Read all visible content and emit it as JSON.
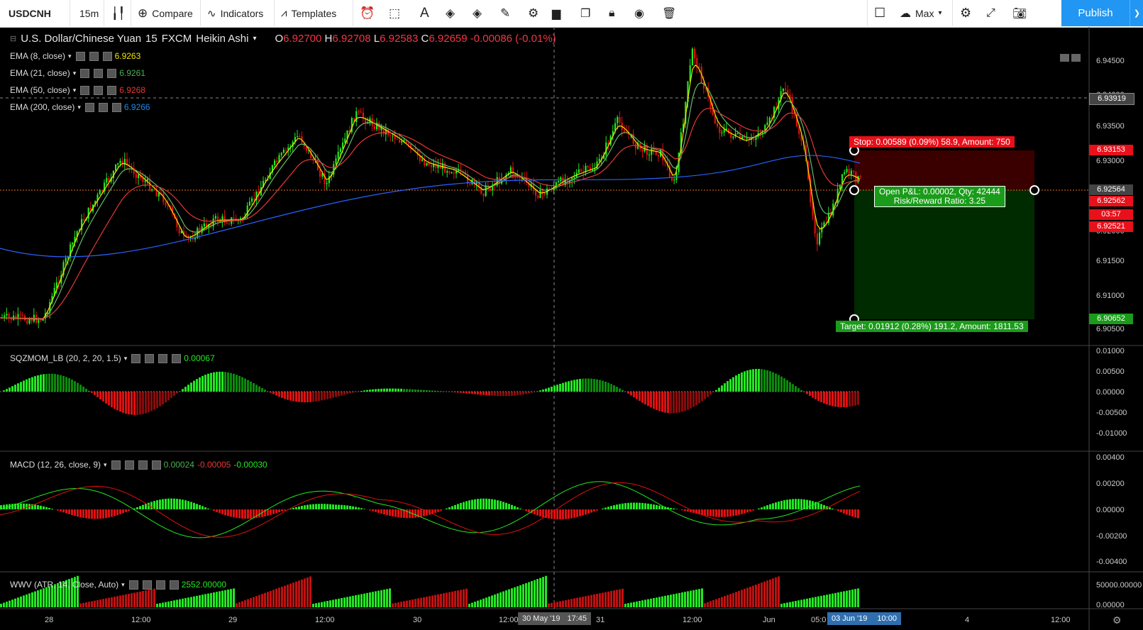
{
  "toolbar": {
    "symbol": "USDCNH",
    "interval": "15m",
    "compare": "Compare",
    "indicators": "Indicators",
    "templates": "Templates",
    "max": "Max",
    "publish": "Publish"
  },
  "header": {
    "title": "U.S. Dollar/Chinese Yuan",
    "interval": "15",
    "exchange": "FXCM",
    "style": "Heikin Ashi",
    "o_label": "O",
    "o": "6.92700",
    "h_label": "H",
    "h": "6.92708",
    "l_label": "L",
    "l": "6.92583",
    "c_label": "C",
    "c": "6.92659",
    "change": "-0.00086 (-0.01%)"
  },
  "legends": {
    "ema8": {
      "label": "EMA (8, close)",
      "value": "6.9263",
      "color": "#f5e400"
    },
    "ema21": {
      "label": "EMA (21, close)",
      "value": "6.9261",
      "color": "#4caf50"
    },
    "ema50": {
      "label": "EMA (50, close)",
      "value": "6.9268",
      "color": "#e53935"
    },
    "ema200": {
      "label": "EMA (200, close)",
      "value": "6.9266",
      "color": "#1e88e5"
    },
    "sqz": {
      "label": "SQZMOM_LB (20, 2, 20, 1.5)",
      "value": "0.00067"
    },
    "macd": {
      "label": "MACD (12, 26, close, 9)",
      "v1": "0.00024",
      "v2": "-0.00005",
      "v3": "-0.00030"
    },
    "wvv": {
      "label": "WWV (ATR, 14, Close, Auto)",
      "value": "2552.00000"
    }
  },
  "position": {
    "stop": "Stop: 0.00589 (0.09%) 58.9, Amount: 750",
    "pnl": "Open P&L: 0.00002, Qty: 42444",
    "rr": "Risk/Reward Ratio: 3.25",
    "target": "Target: 0.01912 (0.28%) 191.2, Amount: 1811.53"
  },
  "price_axis": {
    "ticks": [
      "6.94500",
      "6.94000",
      "6.93500",
      "6.93000",
      "6.92500",
      "6.92000",
      "6.91500",
      "6.91000",
      "6.90500"
    ],
    "labels": {
      "crosshair": "6.93919",
      "stop": "6.93153",
      "entry": "6.92564",
      "last": "6.92562",
      "countdown": "03:57",
      "low": "6.92521",
      "target": "6.90652"
    }
  },
  "sqz_axis": [
    "0.01000",
    "0.00500",
    "0.00000",
    "-0.00500",
    "-0.01000"
  ],
  "macd_axis": [
    "0.00400",
    "0.00200",
    "0.00000",
    "-0.00200",
    "-0.00400"
  ],
  "wvv_axis": [
    "50000.00000",
    "0.00000"
  ],
  "time_axis": {
    "ticks": [
      "28",
      "12:00",
      "29",
      "12:00",
      "30",
      "12:00",
      "31",
      "12:00",
      "Jun",
      "05:0",
      "4",
      "12:00"
    ],
    "cursor_date": "30 May '19",
    "cursor_time": "17:45",
    "cursor2_date": "03 Jun '19",
    "cursor2_time": "10:00"
  },
  "colors": {
    "up": "#22e822",
    "down": "#e01010",
    "ema200": "#2962ff",
    "ema50": "#e53935",
    "ema21": "#66bb6a",
    "ema8": "#f5e400",
    "stop_zone": "#3a0000",
    "target_zone": "#002a00"
  }
}
